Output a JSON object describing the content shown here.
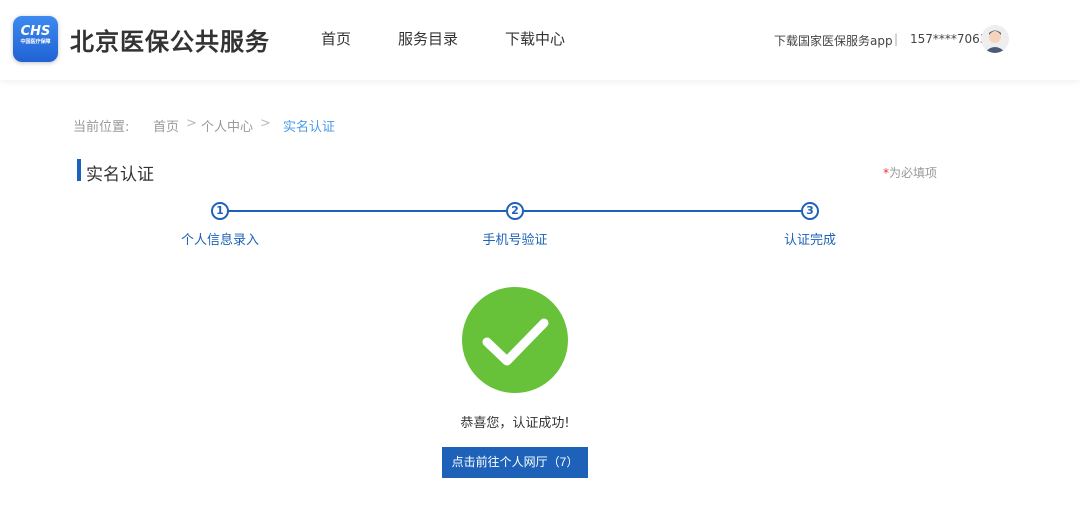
{
  "header": {
    "logo_text": "CHS",
    "logo_sub": "中国医疗保障",
    "site_title": "北京医保公共服务",
    "nav": [
      "首页",
      "服务目录",
      "下载中心"
    ],
    "download_app": "下载国家医保服务app",
    "separator": "|",
    "phone": "157****7063"
  },
  "breadcrumb": {
    "label": "当前位置:",
    "items": [
      "首页",
      "个人中心",
      "实名认证"
    ],
    "sep": ">"
  },
  "page": {
    "title": "实名认证",
    "required_star": "*",
    "required_note": "为必填项"
  },
  "steps": [
    {
      "num": "1",
      "label": "个人信息录入"
    },
    {
      "num": "2",
      "label": "手机号验证"
    },
    {
      "num": "3",
      "label": "认证完成"
    }
  ],
  "result": {
    "message": "恭喜您，认证成功!",
    "button": "点击前往个人网厅（7）"
  },
  "colors": {
    "primary": "#1d62b8",
    "success": "#67c23a",
    "active_crumb": "#4a9be8"
  }
}
